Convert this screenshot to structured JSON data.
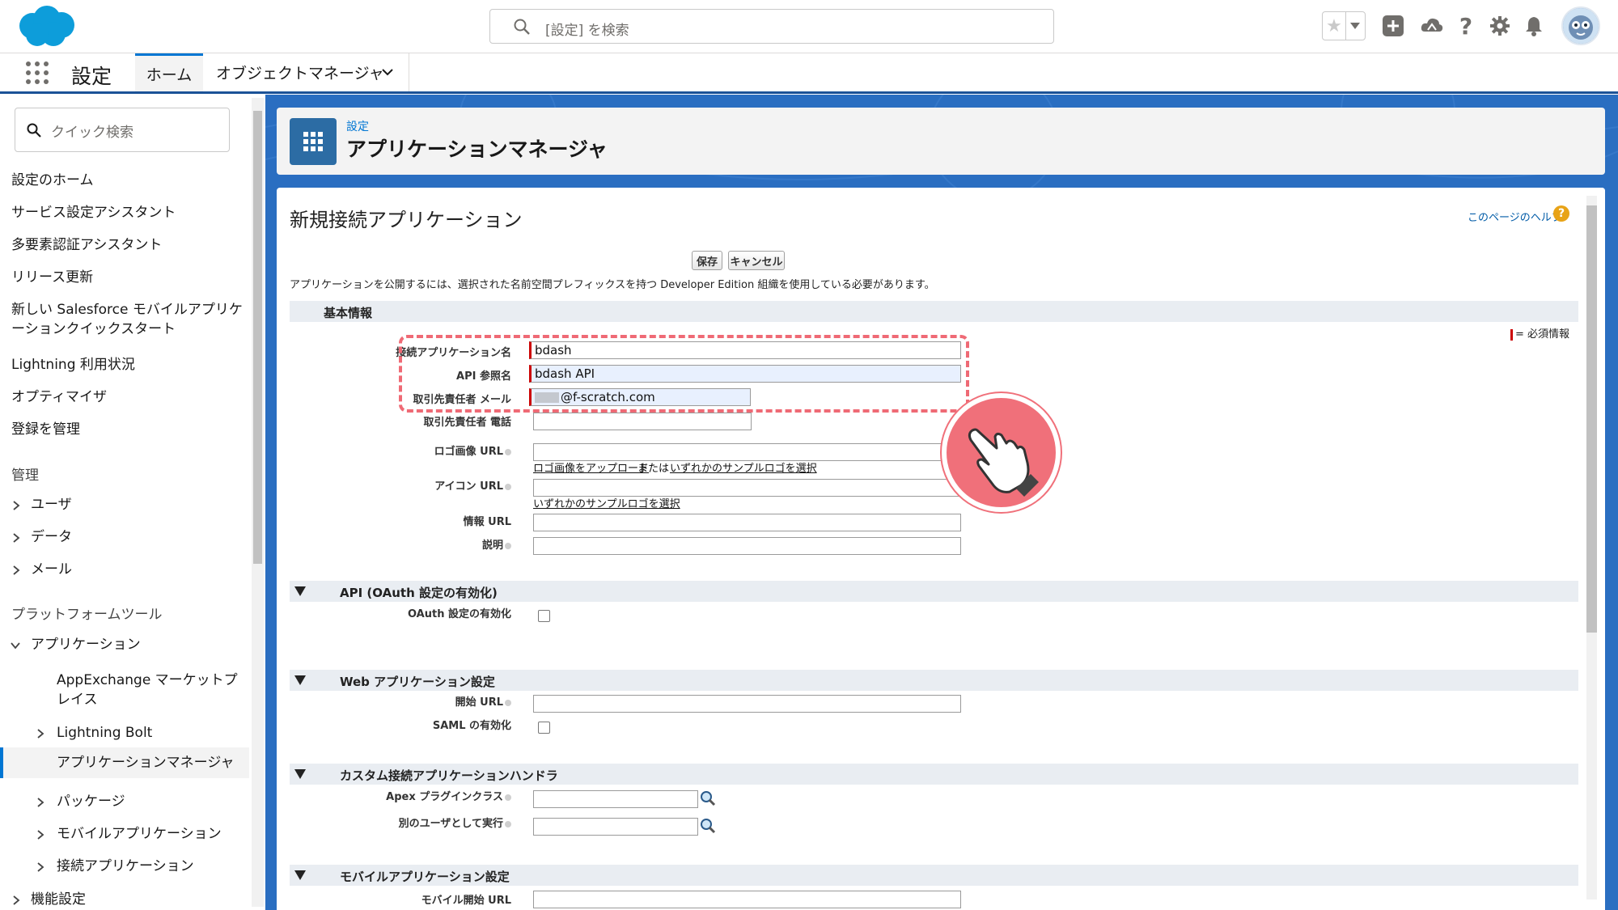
{
  "header": {
    "search_placeholder": "[設定] を検索",
    "icons": [
      "favorites-star-icon",
      "favorites-dropdown-icon",
      "global-actions-icon",
      "trailhead-icon",
      "help-icon",
      "setup-gear-icon",
      "notifications-bell-icon",
      "user-avatar"
    ]
  },
  "nav": {
    "app_name": "設定",
    "tabs": [
      {
        "label": "ホーム",
        "active": true
      },
      {
        "label": "オブジェクトマネージャ",
        "active": false
      }
    ]
  },
  "sidebar": {
    "quick_find_placeholder": "クイック検索",
    "items": [
      "設定のホーム",
      "サービス設定アシスタント",
      "多要素認証アシスタント",
      "リリース更新",
      "新しい Salesforce モバイルアプリケーションクイックスタート",
      "Lightning 利用状況",
      "オプティマイザ",
      "登録を管理"
    ],
    "section_admin": "管理",
    "admin_items": [
      "ユーザ",
      "データ",
      "メール"
    ],
    "section_platform": "プラットフォームツール",
    "platform_group": "アプリケーション",
    "app_sub_items": [
      "AppExchange マーケットプレイス",
      "Lightning Bolt",
      "アプリケーションマネージャ",
      "パッケージ",
      "モバイルアプリケーション",
      "接続アプリケーション"
    ],
    "selected": "アプリケーションマネージャ",
    "feature_settings": "機能設定"
  },
  "page_header": {
    "breadcrumb": "設定",
    "title": "アプリケーションマネージャ"
  },
  "form": {
    "title": "新規接続アプリケーション",
    "help_link": "このページのヘルプ",
    "help_icon": "?",
    "save_label": "保存",
    "cancel_label": "キャンセル",
    "notice": "アプリケーションを公開するには、選択された名前空間プレフィックスを持つ Developer Edition 組織を使用している必要があります。",
    "required_legend": "= 必須情報",
    "sections": {
      "basic": "基本情報",
      "api": "API (OAuth 設定の有効化)",
      "web": "Web アプリケーション設定",
      "custom_handler": "カスタム接続アプリケーションハンドラ",
      "mobile": "モバイルアプリケーション設定"
    },
    "fields": {
      "connected_app_name": {
        "label": "接続アプリケーション名",
        "value": "bdash"
      },
      "api_name": {
        "label": "API 参照名",
        "value": "bdash API"
      },
      "contact_email": {
        "label": "取引先責任者 メール",
        "value": "@f-scratch.com"
      },
      "contact_phone": {
        "label": "取引先責任者 電話",
        "value": ""
      },
      "logo_url": {
        "label": "ロゴ画像 URL",
        "value": ""
      },
      "logo_link_upload": "ロゴ画像をアップロード",
      "logo_link_or": "または",
      "logo_link_sample": "いずれかのサンプルロゴを選択",
      "icon_url": {
        "label": "アイコン URL",
        "value": ""
      },
      "icon_link_sample": "いずれかのサンプルロゴを選択",
      "info_url": {
        "label": "情報 URL",
        "value": ""
      },
      "description": {
        "label": "説明",
        "value": ""
      },
      "oauth_enable": {
        "label": "OAuth 設定の有効化",
        "checked": false
      },
      "start_url": {
        "label": "開始 URL",
        "value": ""
      },
      "saml_enable": {
        "label": "SAML の有効化",
        "checked": false
      },
      "apex_plugin": {
        "label": "Apex プラグインクラス",
        "value": ""
      },
      "run_as": {
        "label": "別のユーザとして実行",
        "value": ""
      },
      "mobile_start_url": {
        "label": "モバイル開始 URL"
      }
    }
  },
  "colors": {
    "brand_blue": "#0176d3",
    "header_blue": "#2a6ec1",
    "highlight_pink": "#ef6a75",
    "required_red": "#cc0000"
  }
}
